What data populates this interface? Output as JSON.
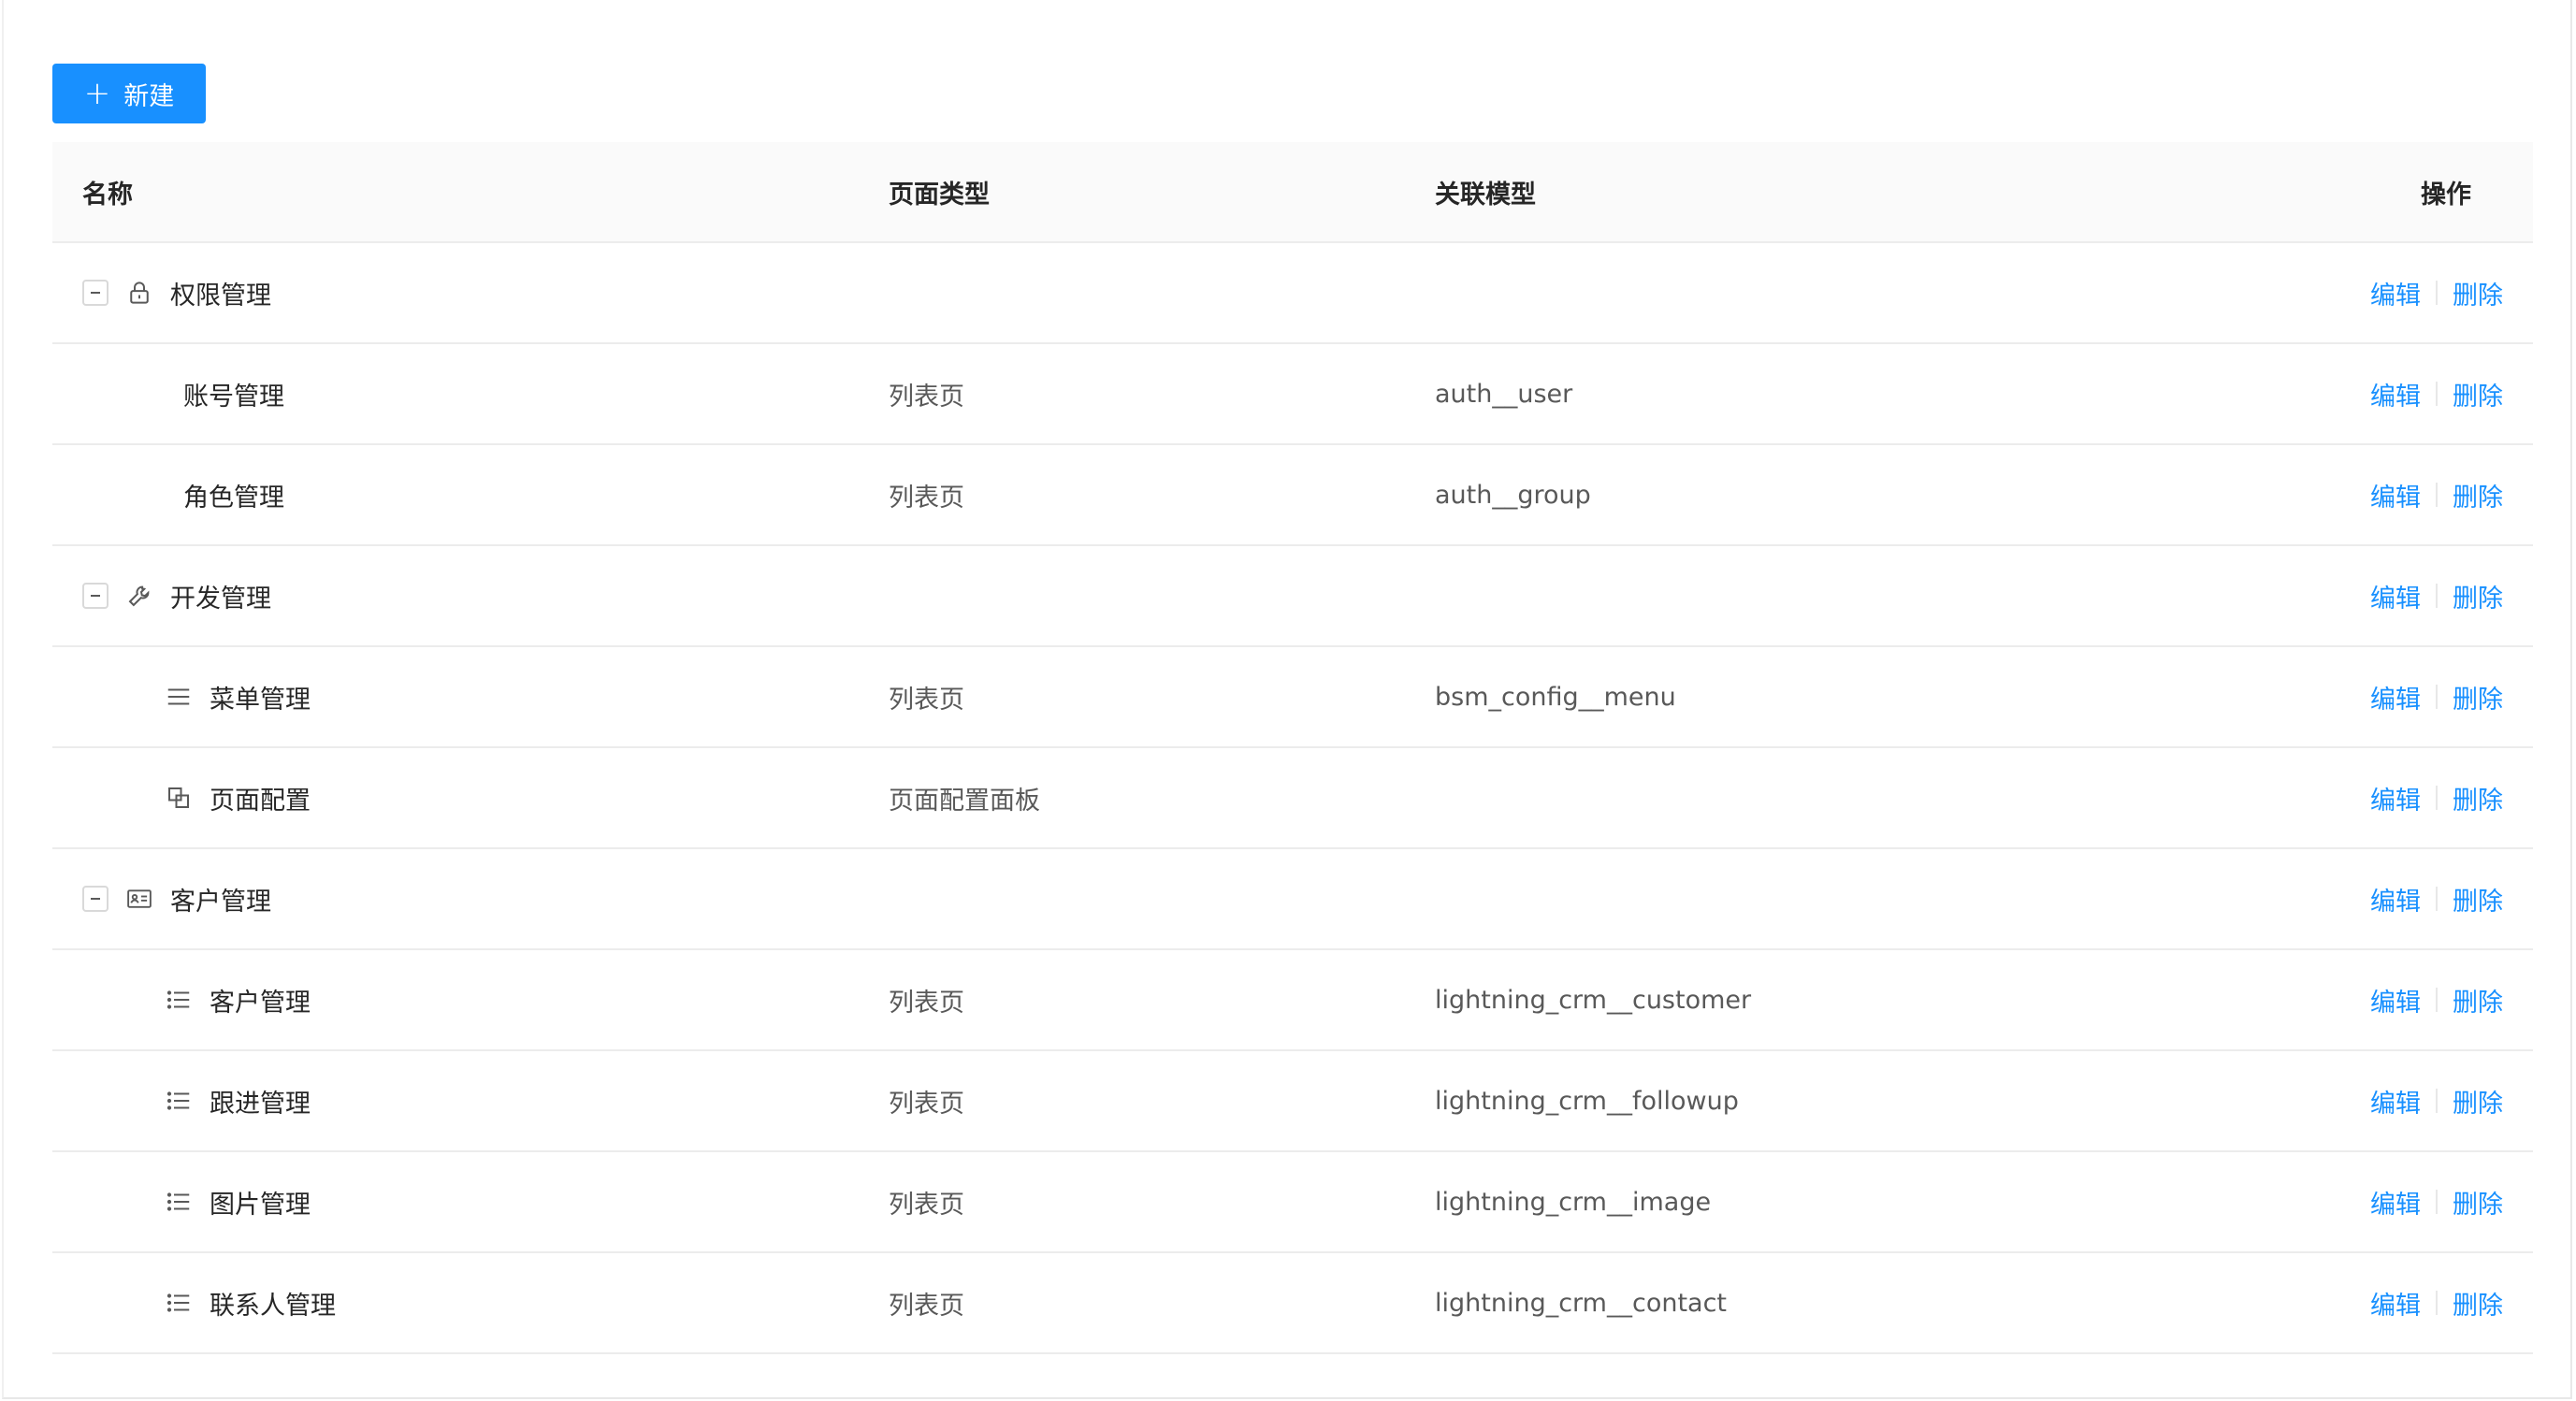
{
  "toolbar": {
    "new_label": "新建",
    "new_icon": "plus-icon"
  },
  "columns": {
    "name": "名称",
    "page_type": "页面类型",
    "model": "关联模型",
    "actions": "操作"
  },
  "actions": {
    "edit": "编辑",
    "delete": "删除"
  },
  "accent_color": "#1890ff",
  "rows": [
    {
      "name": "权限管理",
      "page_type": "",
      "model": "",
      "level": 0,
      "icon": "lock-icon",
      "expanded": true
    },
    {
      "name": "账号管理",
      "page_type": "列表页",
      "model": "auth__user",
      "level": 1,
      "icon": ""
    },
    {
      "name": "角色管理",
      "page_type": "列表页",
      "model": "auth__group",
      "level": 1,
      "icon": ""
    },
    {
      "name": "开发管理",
      "page_type": "",
      "model": "",
      "level": 0,
      "icon": "wrench-icon",
      "expanded": true
    },
    {
      "name": "菜单管理",
      "page_type": "列表页",
      "model": "bsm_config__menu",
      "level": 1,
      "icon": "menu-icon"
    },
    {
      "name": "页面配置",
      "page_type": "页面配置面板",
      "model": "",
      "level": 1,
      "icon": "layers-icon"
    },
    {
      "name": "客户管理",
      "page_type": "",
      "model": "",
      "level": 0,
      "icon": "id-card-icon",
      "expanded": true
    },
    {
      "name": "客户管理",
      "page_type": "列表页",
      "model": "lightning_crm__customer",
      "level": 1,
      "icon": "list-icon"
    },
    {
      "name": "跟进管理",
      "page_type": "列表页",
      "model": "lightning_crm__followup",
      "level": 1,
      "icon": "list-icon"
    },
    {
      "name": "图片管理",
      "page_type": "列表页",
      "model": "lightning_crm__image",
      "level": 1,
      "icon": "list-icon"
    },
    {
      "name": "联系人管理",
      "page_type": "列表页",
      "model": "lightning_crm__contact",
      "level": 1,
      "icon": "list-icon"
    }
  ]
}
